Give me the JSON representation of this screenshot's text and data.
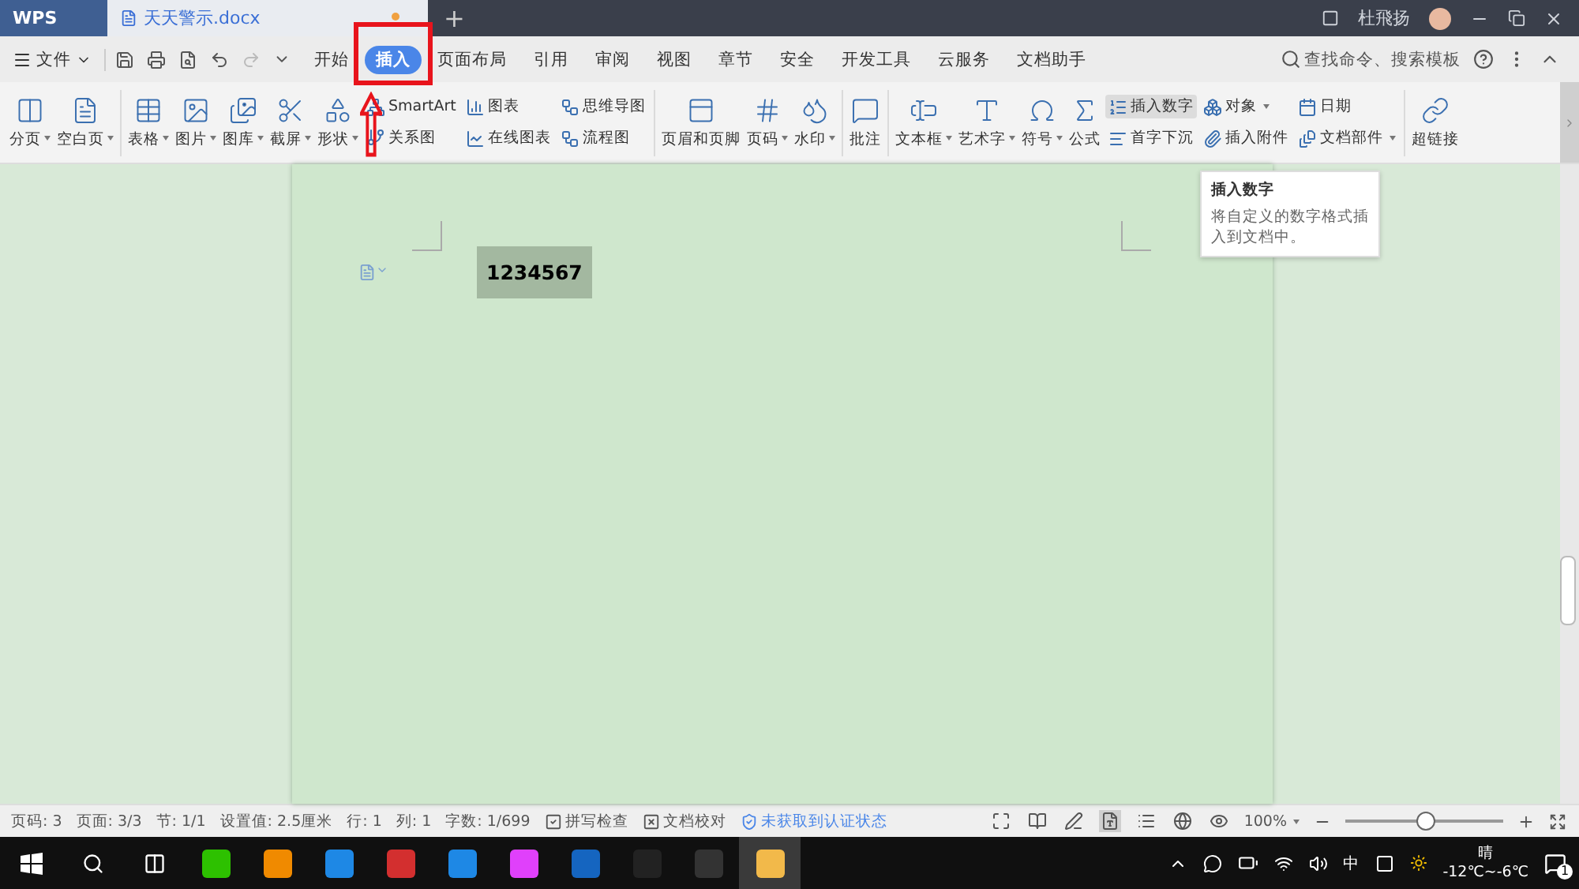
{
  "title_bar": {
    "app_tab": "WPS",
    "doc_tab": {
      "title": "天天警示.docx",
      "unsaved": true
    },
    "new_tab": "+",
    "user": "杜飛扬"
  },
  "menu_bar": {
    "file": "文件",
    "tabs": [
      {
        "label": "开始",
        "selected": false
      },
      {
        "label": "插入",
        "selected": true
      },
      {
        "label": "页面布局",
        "selected": false
      },
      {
        "label": "引用",
        "selected": false
      },
      {
        "label": "审阅",
        "selected": false
      },
      {
        "label": "视图",
        "selected": false
      },
      {
        "label": "章节",
        "selected": false
      },
      {
        "label": "安全",
        "selected": false
      },
      {
        "label": "开发工具",
        "selected": false
      },
      {
        "label": "云服务",
        "selected": false
      },
      {
        "label": "文档助手",
        "selected": false
      }
    ],
    "search": "查找命令、搜索模板"
  },
  "ribbon": [
    {
      "kind": "big",
      "label": "分页",
      "dropdown": true
    },
    {
      "kind": "big",
      "label": "空白页",
      "dropdown": true
    },
    {
      "kind": "sep"
    },
    {
      "kind": "big",
      "label": "表格",
      "dropdown": true
    },
    {
      "kind": "big",
      "label": "图片",
      "dropdown": true
    },
    {
      "kind": "big",
      "label": "图库",
      "dropdown": true
    },
    {
      "kind": "big",
      "label": "截屏",
      "dropdown": true
    },
    {
      "kind": "big",
      "label": "形状",
      "dropdown": true
    },
    {
      "kind": "pair",
      "items": [
        {
          "label": "SmartArt",
          "dropdown": false,
          "highlighted": false
        },
        {
          "label": "关系图",
          "dropdown": false,
          "highlighted": false
        }
      ]
    },
    {
      "kind": "pair",
      "items": [
        {
          "label": "图表",
          "dropdown": false,
          "highlighted": false
        },
        {
          "label": "在线图表",
          "dropdown": false,
          "highlighted": false
        }
      ]
    },
    {
      "kind": "pair",
      "items": [
        {
          "label": "思维导图",
          "dropdown": false,
          "highlighted": false
        },
        {
          "label": "流程图",
          "dropdown": false,
          "highlighted": false
        }
      ]
    },
    {
      "kind": "sep"
    },
    {
      "kind": "big",
      "label": "页眉和页脚",
      "dropdown": false
    },
    {
      "kind": "big",
      "label": "页码",
      "dropdown": true
    },
    {
      "kind": "big",
      "label": "水印",
      "dropdown": true
    },
    {
      "kind": "sep"
    },
    {
      "kind": "big",
      "label": "批注",
      "dropdown": false
    },
    {
      "kind": "sep"
    },
    {
      "kind": "big",
      "label": "文本框",
      "dropdown": true
    },
    {
      "kind": "big",
      "label": "艺术字",
      "dropdown": true
    },
    {
      "kind": "big",
      "label": "符号",
      "dropdown": true
    },
    {
      "kind": "big",
      "label": "公式",
      "dropdown": false
    },
    {
      "kind": "pair",
      "items": [
        {
          "label": "插入数字",
          "dropdown": false,
          "highlighted": true
        },
        {
          "label": "首字下沉",
          "dropdown": false,
          "highlighted": false
        }
      ]
    },
    {
      "kind": "pair",
      "items": [
        {
          "label": "对象",
          "dropdown": true,
          "highlighted": false
        },
        {
          "label": "插入附件",
          "dropdown": false,
          "highlighted": false
        }
      ]
    },
    {
      "kind": "pair",
      "items": [
        {
          "label": "日期",
          "dropdown": false,
          "highlighted": false
        },
        {
          "label": "文档部件",
          "dropdown": true,
          "highlighted": false
        }
      ]
    },
    {
      "kind": "sep"
    },
    {
      "kind": "big",
      "label": "超链接",
      "dropdown": false
    }
  ],
  "tooltip": {
    "title": "插入数字",
    "body": "将自定义的数字格式插入到文档中。"
  },
  "document": {
    "text": "1234567",
    "selected": true
  },
  "status_bar": {
    "items": [
      "页码: 3",
      "页面: 3/3",
      "节: 1/1",
      "设置值: 2.5厘米",
      "行: 1",
      "列: 1",
      "字数: 1/699"
    ],
    "spell_check": "拼写检查",
    "doc_check": "文档校对",
    "auth": "未获取到认证状态",
    "views": [
      {
        "selected": false
      },
      {
        "selected": false
      },
      {
        "selected": false
      },
      {
        "selected": true
      },
      {
        "selected": false
      },
      {
        "selected": false
      },
      {
        "selected": false
      }
    ],
    "zoom": "100%",
    "zoom_slider": {
      "level": 0.5
    }
  },
  "taskbar": {
    "apps": [
      {
        "selected": false
      },
      {
        "selected": false
      },
      {
        "selected": false
      },
      {
        "selected": false
      },
      {
        "selected": false
      },
      {
        "selected": false
      },
      {
        "selected": false
      },
      {
        "selected": false
      },
      {
        "selected": false
      },
      {
        "selected": false
      },
      {
        "selected": false
      },
      {
        "selected": false
      },
      {
        "selected": true
      }
    ],
    "ime": "中",
    "weather": "晴",
    "temperature": "-12℃~-6℃",
    "notifications": "1"
  },
  "annotations": [
    {
      "kind": "frame"
    },
    {
      "kind": "arrow"
    }
  ]
}
